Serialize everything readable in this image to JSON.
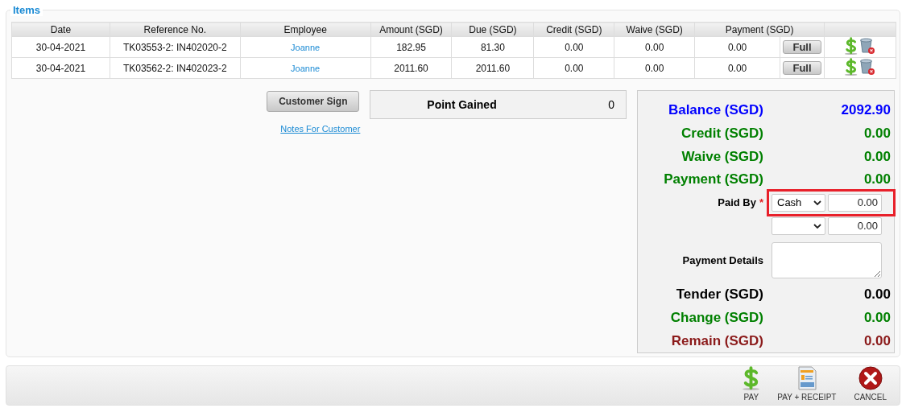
{
  "section": {
    "title": "Items"
  },
  "table": {
    "columns": [
      "Date",
      "Reference No.",
      "Employee",
      "Amount (SGD)",
      "Due (SGD)",
      "Credit (SGD)",
      "Waive (SGD)",
      "Payment (SGD)"
    ],
    "rows": [
      {
        "date": "30-04-2021",
        "reference": "TK03553-2: IN402020-2",
        "employee": "Joanne",
        "amount": "182.95",
        "due": "81.30",
        "credit": "0.00",
        "waive": "0.00",
        "payment": "0.00",
        "full_button": "Full"
      },
      {
        "date": "30-04-2021",
        "reference": "TK03562-2: IN402023-2",
        "employee": "Joanne",
        "amount": "2011.60",
        "due": "2011.60",
        "credit": "0.00",
        "waive": "0.00",
        "payment": "0.00",
        "full_button": "Full"
      }
    ]
  },
  "customer_sign_button": "Customer Sign",
  "notes_link": "Notes For Customer",
  "points": {
    "label": "Point Gained",
    "value": "0"
  },
  "totals": [
    {
      "label": "Balance (SGD)",
      "value": "2092.90",
      "color": "#0000ff"
    },
    {
      "label": "Credit (SGD)",
      "value": "0.00",
      "color": "#008000"
    },
    {
      "label": "Waive (SGD)",
      "value": "0.00",
      "color": "#008000"
    },
    {
      "label": "Payment (SGD)",
      "value": "0.00",
      "color": "#008000"
    }
  ],
  "paid_by": {
    "label": "Paid By",
    "required_mark": "*",
    "rows": [
      {
        "method": "Cash",
        "amount": "0.00",
        "highlighted": true
      },
      {
        "amount": "0.00",
        "highlighted": false
      }
    ]
  },
  "payment_details": {
    "label": "Payment Details"
  },
  "results": [
    {
      "label": "Tender (SGD)",
      "value": "0.00",
      "color": "#000000"
    },
    {
      "label": "Change (SGD)",
      "value": "0.00",
      "color": "#008000"
    },
    {
      "label": "Remain (SGD)",
      "value": "0.00",
      "color": "#8b1a1a"
    }
  ],
  "actions": [
    {
      "kind": "pay",
      "label": "PAY"
    },
    {
      "kind": "receipt",
      "label": "PAY + RECEIPT"
    },
    {
      "kind": "cancel",
      "label": "CANCEL"
    }
  ]
}
